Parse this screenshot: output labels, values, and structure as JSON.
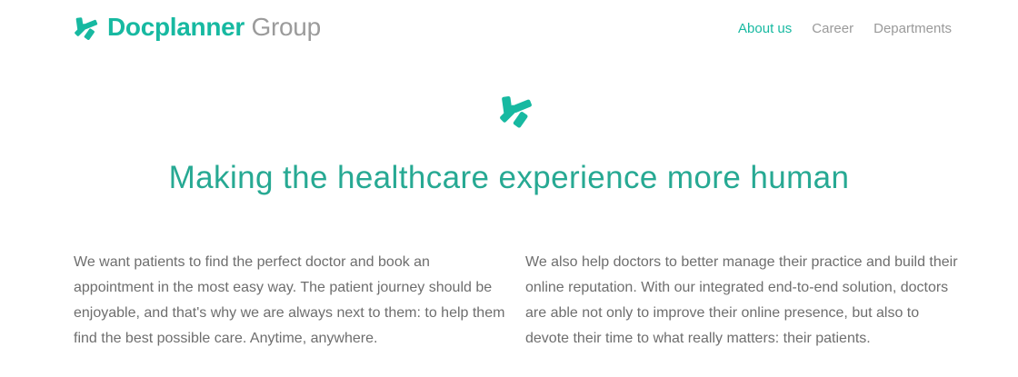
{
  "header": {
    "logo": {
      "brand": "Docplanner",
      "group": "Group",
      "icon": "docplanner-star-icon"
    },
    "nav": [
      {
        "label": "About us",
        "active": true
      },
      {
        "label": "Career",
        "active": false
      },
      {
        "label": "Departments",
        "active": false
      }
    ]
  },
  "hero": {
    "icon": "docplanner-star-icon",
    "headline": "Making the healthcare experience more human"
  },
  "body": {
    "left_paragraph": "We want patients to find the perfect doctor and book an appointment in the most easy way. The patient journey should be enjoyable, and that's why we are always next to them: to help them find the best possible care. Anytime, anywhere.",
    "right_paragraph": "We also help doctors to better manage their practice and build their online reputation. With our integrated end-to-end solution, doctors are able not only to improve their online presence, but also to devote their time to what really matters: their patients."
  },
  "colors": {
    "accent": "#17b9a1",
    "headline": "#27a993",
    "muted": "#9a9a9a",
    "body_text": "#6e6e6e"
  }
}
